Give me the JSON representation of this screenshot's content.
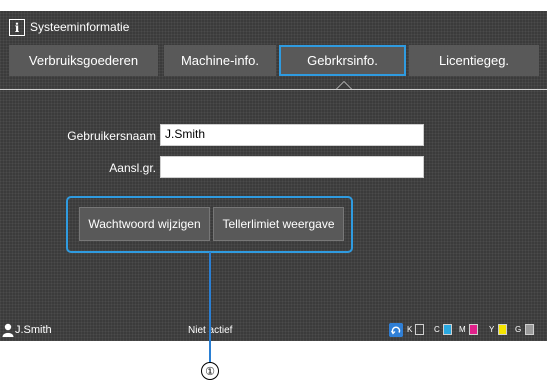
{
  "header": {
    "title": "Systeeminformatie",
    "icon": "info-icon"
  },
  "tabs": [
    {
      "label": "Verbruiksgoederen",
      "active": false
    },
    {
      "label": "Machine-info.",
      "active": false
    },
    {
      "label": "Gebrkrsinfo.",
      "active": true
    },
    {
      "label": "Licentiegeg.",
      "active": false
    }
  ],
  "form": {
    "username_label": "Gebruikersnaam",
    "username_value": "J.Smith",
    "group_label": "Aansl.gr.",
    "group_value": ""
  },
  "buttons": {
    "change_password": "Wachtwoord wijzigen",
    "counter_limit": "Tellerlimiet weergave"
  },
  "status_bar": {
    "user": "J.Smith",
    "status": "Niet actief",
    "ink": [
      {
        "letter": "K",
        "color": "#1a1a1a"
      },
      {
        "letter": "C",
        "color": "#29a8e0"
      },
      {
        "letter": "M",
        "color": "#e0218a"
      },
      {
        "letter": "Y",
        "color": "#f5e400"
      },
      {
        "letter": "G",
        "color": "#9a9a9a"
      }
    ]
  },
  "callout": {
    "number": "①"
  },
  "colors": {
    "accent": "#2f9be0",
    "background": "#3b3b3b",
    "tab": "#595959"
  }
}
